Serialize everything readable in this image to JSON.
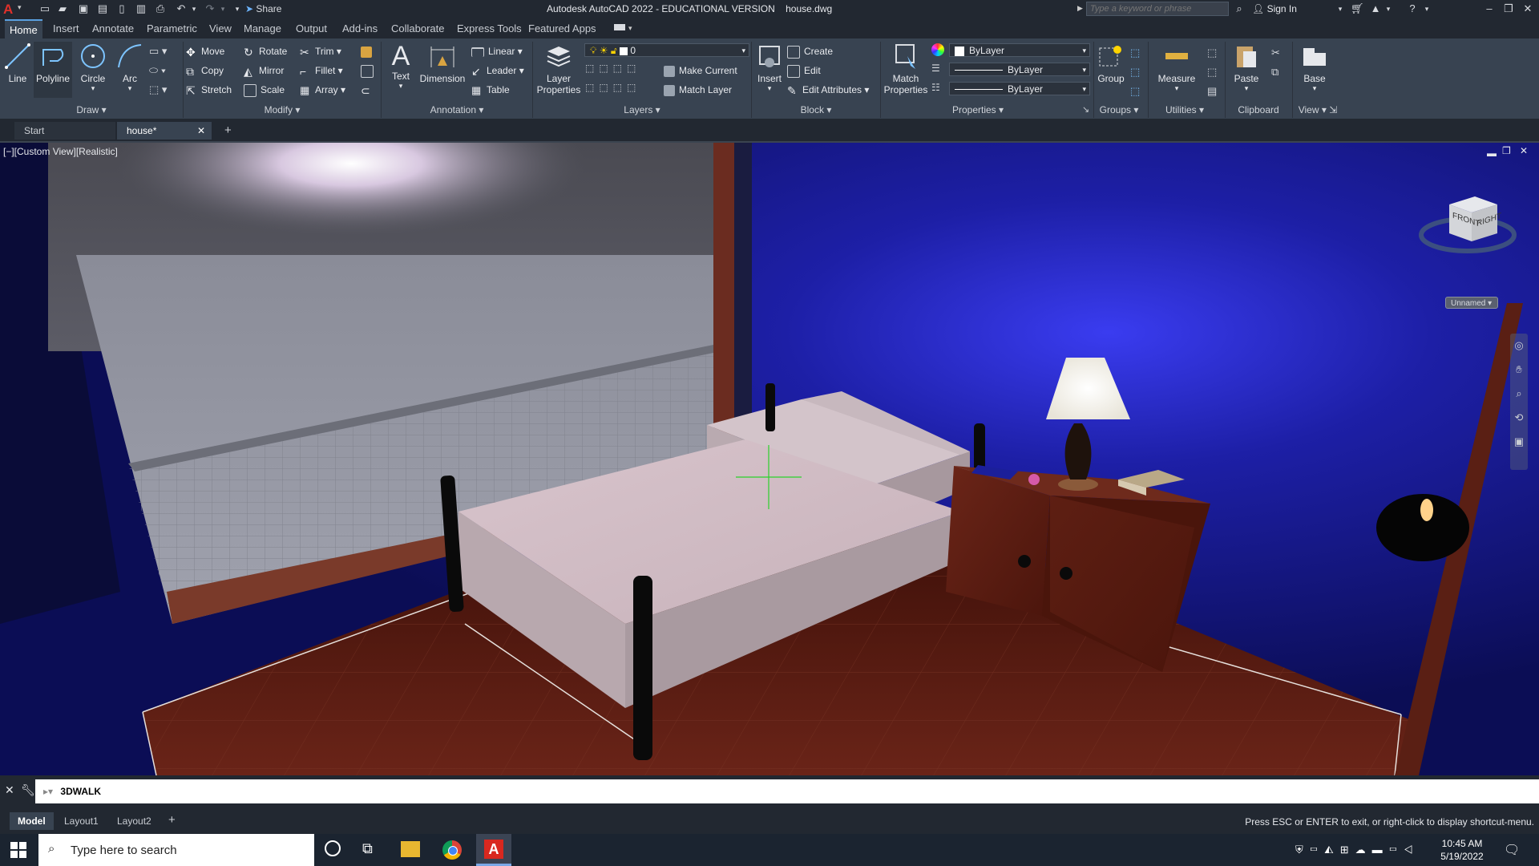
{
  "title_bar": {
    "app_title": "Autodesk AutoCAD 2022 - EDUCATIONAL VERSION",
    "file_name": "house.dwg",
    "share_label": "Share",
    "search_placeholder": "Type a keyword or phrase",
    "sign_in_label": "Sign In"
  },
  "ribbon_tabs": [
    "Home",
    "Insert",
    "Annotate",
    "Parametric",
    "View",
    "Manage",
    "Output",
    "Add-ins",
    "Collaborate",
    "Express Tools",
    "Featured Apps"
  ],
  "ribbon": {
    "draw": {
      "title": "Draw",
      "line": "Line",
      "polyline": "Polyline",
      "circle": "Circle",
      "arc": "Arc"
    },
    "modify": {
      "title": "Modify",
      "move": "Move",
      "rotate": "Rotate",
      "trim": "Trim",
      "copy": "Copy",
      "mirror": "Mirror",
      "fillet": "Fillet",
      "stretch": "Stretch",
      "scale": "Scale",
      "array": "Array"
    },
    "annotation": {
      "title": "Annotation",
      "text": "Text",
      "dimension": "Dimension",
      "linear": "Linear",
      "leader": "Leader",
      "table": "Table"
    },
    "layers": {
      "title": "Layers",
      "layer_properties": "Layer Properties",
      "current_layer": "0",
      "make_current": "Make Current",
      "match_layer": "Match Layer"
    },
    "block": {
      "title": "Block",
      "insert": "Insert",
      "create": "Create",
      "edit": "Edit",
      "edit_attributes": "Edit Attributes"
    },
    "properties": {
      "title": "Properties",
      "match_properties": "Match Properties",
      "color": "ByLayer",
      "linetype": "ByLayer",
      "lineweight": "ByLayer"
    },
    "groups": {
      "title": "Groups",
      "group": "Group"
    },
    "utilities": {
      "title": "Utilities",
      "measure": "Measure"
    },
    "clipboard": {
      "title": "Clipboard",
      "paste": "Paste"
    },
    "view": {
      "title": "View",
      "base": "Base"
    }
  },
  "doc_tabs": {
    "start": "Start",
    "house": "house*"
  },
  "viewport": {
    "view_label": "[−][Custom View][Realistic]",
    "viewcube_front": "FRONT",
    "viewcube_right": "RIGHT",
    "ucs_name": "Unnamed"
  },
  "command": {
    "text": "3DWALK"
  },
  "layout_tabs": [
    "Model",
    "Layout1",
    "Layout2"
  ],
  "status_message": "Press ESC or ENTER to exit, or right-click to display shortcut-menu.",
  "taskbar": {
    "search_placeholder": "Type here to search",
    "time": "10:45 AM",
    "date": "5/19/2022"
  },
  "colors": {
    "titlebar": "#222831",
    "ribbon": "#384351",
    "wall_blue": "#1b1d9a",
    "floor": "#5a1d14",
    "accent": "#5aa0e0"
  }
}
